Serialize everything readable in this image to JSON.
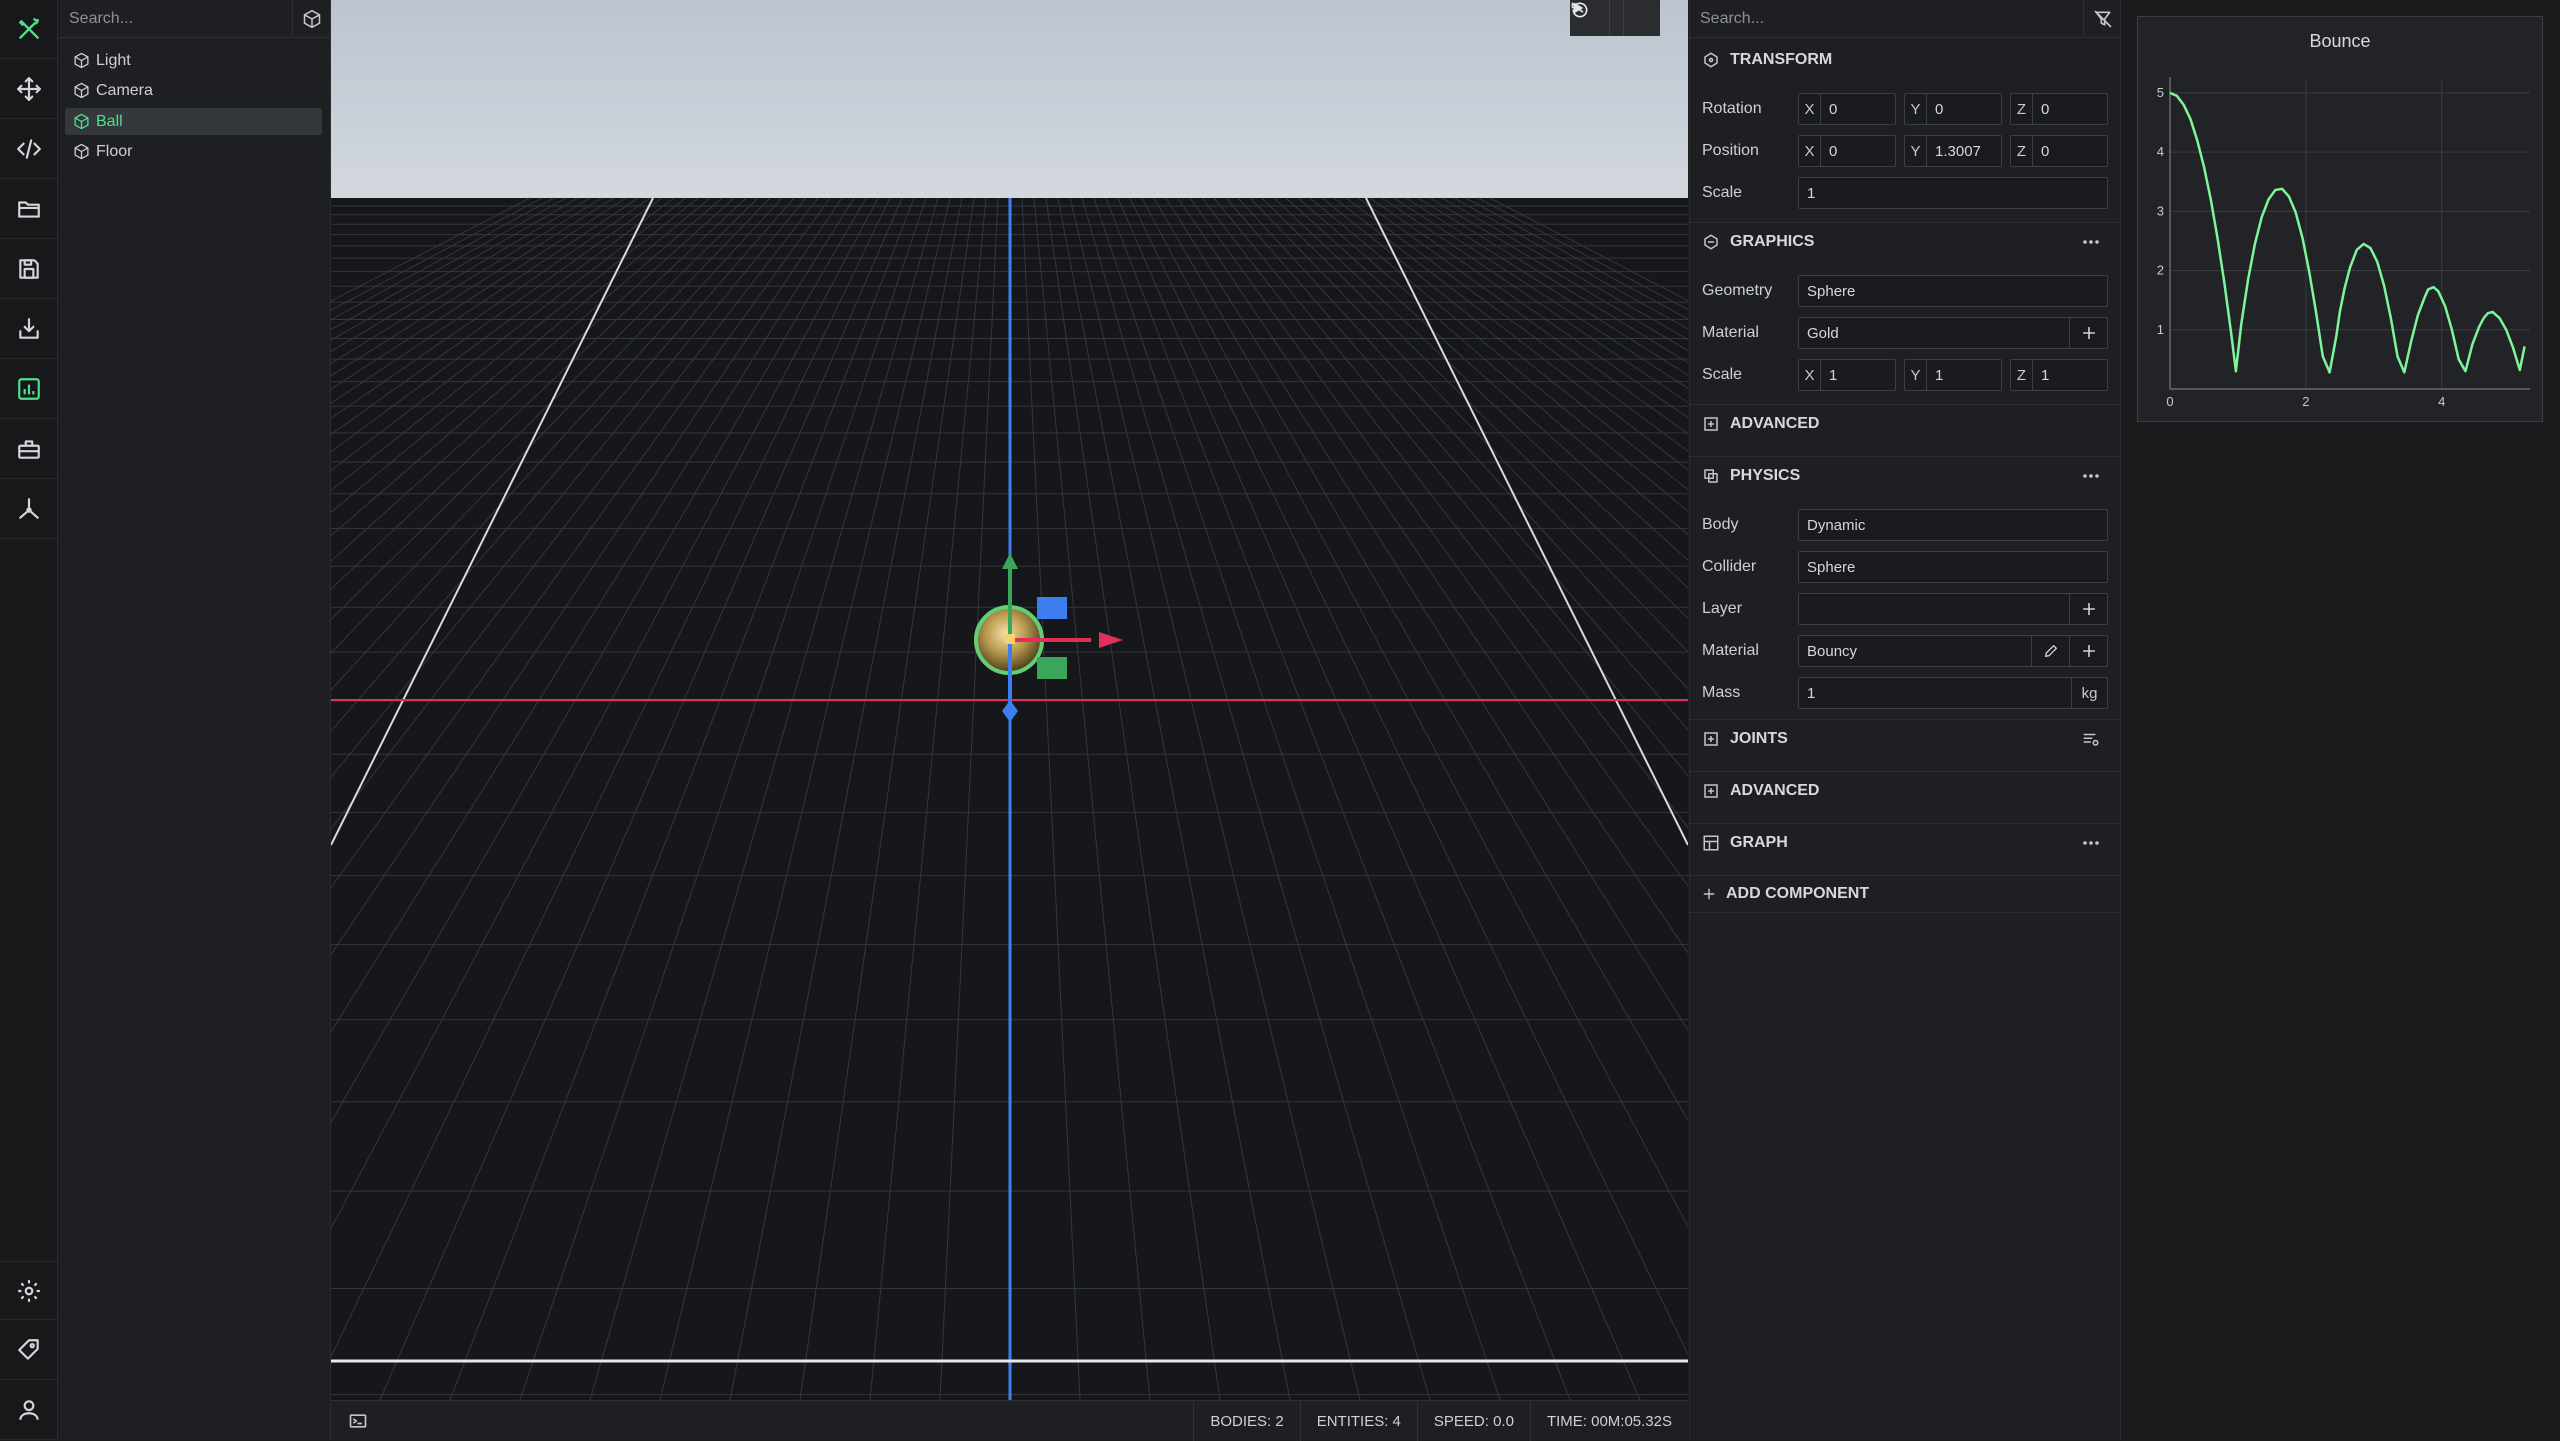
{
  "rail": {
    "items": [
      {
        "icon": "tools-icon",
        "label": "Tools"
      },
      {
        "icon": "move-icon",
        "label": "Move"
      },
      {
        "icon": "code-icon",
        "label": "Code"
      },
      {
        "icon": "folder-icon",
        "label": "Open"
      },
      {
        "icon": "save-icon",
        "label": "Save"
      },
      {
        "icon": "download-icon",
        "label": "Import"
      },
      {
        "icon": "chart-icon",
        "label": "Graph"
      },
      {
        "icon": "toolbox-icon",
        "label": "Toolbox"
      },
      {
        "icon": "axes-icon",
        "label": "Axes"
      }
    ],
    "bottom_items": [
      {
        "icon": "gear-icon",
        "label": "Settings"
      },
      {
        "icon": "tag-icon",
        "label": "Tags"
      },
      {
        "icon": "user-icon",
        "label": "Account"
      }
    ],
    "accent": "#4fe08a"
  },
  "hierarchy": {
    "search_placeholder": "Search...",
    "add_icon": "cube-icon",
    "items": [
      {
        "label": "Light",
        "selected": false
      },
      {
        "label": "Camera",
        "selected": false
      },
      {
        "label": "Ball",
        "selected": true
      },
      {
        "label": "Floor",
        "selected": false
      }
    ]
  },
  "viewport": {
    "toolbar": {
      "play_icon": "play-icon",
      "dropdown_icon": "chevron-down-icon",
      "history_icon": "history-icon"
    },
    "colors": {
      "sky": "#c9d0da",
      "floor": "#16171a",
      "grid": "#3b3e44",
      "x_axis": "#e0305a",
      "y_axis": "#3aa65a",
      "z_axis": "#3d7ff0"
    }
  },
  "status": {
    "console_icon": "console-icon",
    "bodies": "BODIES: 2",
    "entities": "ENTITIES: 4",
    "speed": "SPEED: 0.0",
    "time": "TIME: 00M:05.32S"
  },
  "inspector": {
    "search_placeholder": "Search...",
    "clear_icon": "filter-off-icon",
    "transform": {
      "title": "TRANSFORM",
      "rotation_label": "Rotation",
      "rotation": {
        "x": "0",
        "y": "0",
        "z": "0"
      },
      "position_label": "Position",
      "position": {
        "x": "0",
        "y": "1.3007",
        "z": "0"
      },
      "scale_label": "Scale",
      "scale": "1"
    },
    "graphics": {
      "title": "GRAPHICS",
      "geometry_label": "Geometry",
      "geometry": "Sphere",
      "material_label": "Material",
      "material": "Gold",
      "scale_label": "Scale",
      "scale": {
        "x": "1",
        "y": "1",
        "z": "1"
      }
    },
    "advanced_1": "ADVANCED",
    "physics": {
      "title": "PHYSICS",
      "body_label": "Body",
      "body": "Dynamic",
      "collider_label": "Collider",
      "collider": "Sphere",
      "layer_label": "Layer",
      "layer": "",
      "material_label": "Material",
      "material": "Bouncy",
      "mass_label": "Mass",
      "mass": "1",
      "mass_unit": "kg"
    },
    "joints": "JOINTS",
    "advanced_2": "ADVANCED",
    "graph": "GRAPH",
    "add_component": "ADD COMPONENT",
    "axis_labels": {
      "x": "X",
      "y": "Y",
      "z": "Z"
    }
  },
  "chart_data": {
    "type": "line",
    "title": "Bounce",
    "xlabel": "",
    "ylabel": "",
    "xlim": [
      0,
      5.3
    ],
    "ylim": [
      0,
      5.2
    ],
    "xticks": [
      0,
      2,
      4
    ],
    "yticks": [
      1,
      2,
      3,
      4,
      5
    ],
    "grid": true,
    "color": "#7ef59a",
    "series": [
      {
        "x": [
          0,
          0.1,
          0.2,
          0.3,
          0.4,
          0.5,
          0.6,
          0.7,
          0.8,
          0.9,
          0.97,
          1.05,
          1.15,
          1.25,
          1.35,
          1.45,
          1.55,
          1.65,
          1.75,
          1.85,
          1.95,
          2.05,
          2.15,
          2.25,
          2.35,
          2.45,
          2.5,
          2.57,
          2.65,
          2.75,
          2.85,
          2.95,
          3.05,
          3.15,
          3.25,
          3.35,
          3.45,
          3.55,
          3.65,
          3.75,
          3.8,
          3.88,
          3.95,
          4.05,
          4.15,
          4.25,
          4.35,
          4.45,
          4.55,
          4.62,
          4.68,
          4.75,
          4.85,
          4.95,
          5.05,
          5.15,
          5.22
        ],
        "y": [
          5.0,
          4.95,
          4.8,
          4.56,
          4.2,
          3.75,
          3.2,
          2.55,
          1.8,
          0.95,
          0.3,
          1.1,
          1.85,
          2.45,
          2.9,
          3.2,
          3.36,
          3.38,
          3.25,
          2.98,
          2.55,
          1.98,
          1.3,
          0.55,
          0.28,
          0.9,
          1.3,
          1.7,
          2.05,
          2.35,
          2.45,
          2.38,
          2.15,
          1.75,
          1.2,
          0.55,
          0.28,
          0.8,
          1.25,
          1.55,
          1.68,
          1.72,
          1.65,
          1.4,
          1.0,
          0.5,
          0.3,
          0.75,
          1.05,
          1.2,
          1.28,
          1.3,
          1.2,
          1.0,
          0.7,
          0.32,
          0.72
        ]
      }
    ]
  }
}
